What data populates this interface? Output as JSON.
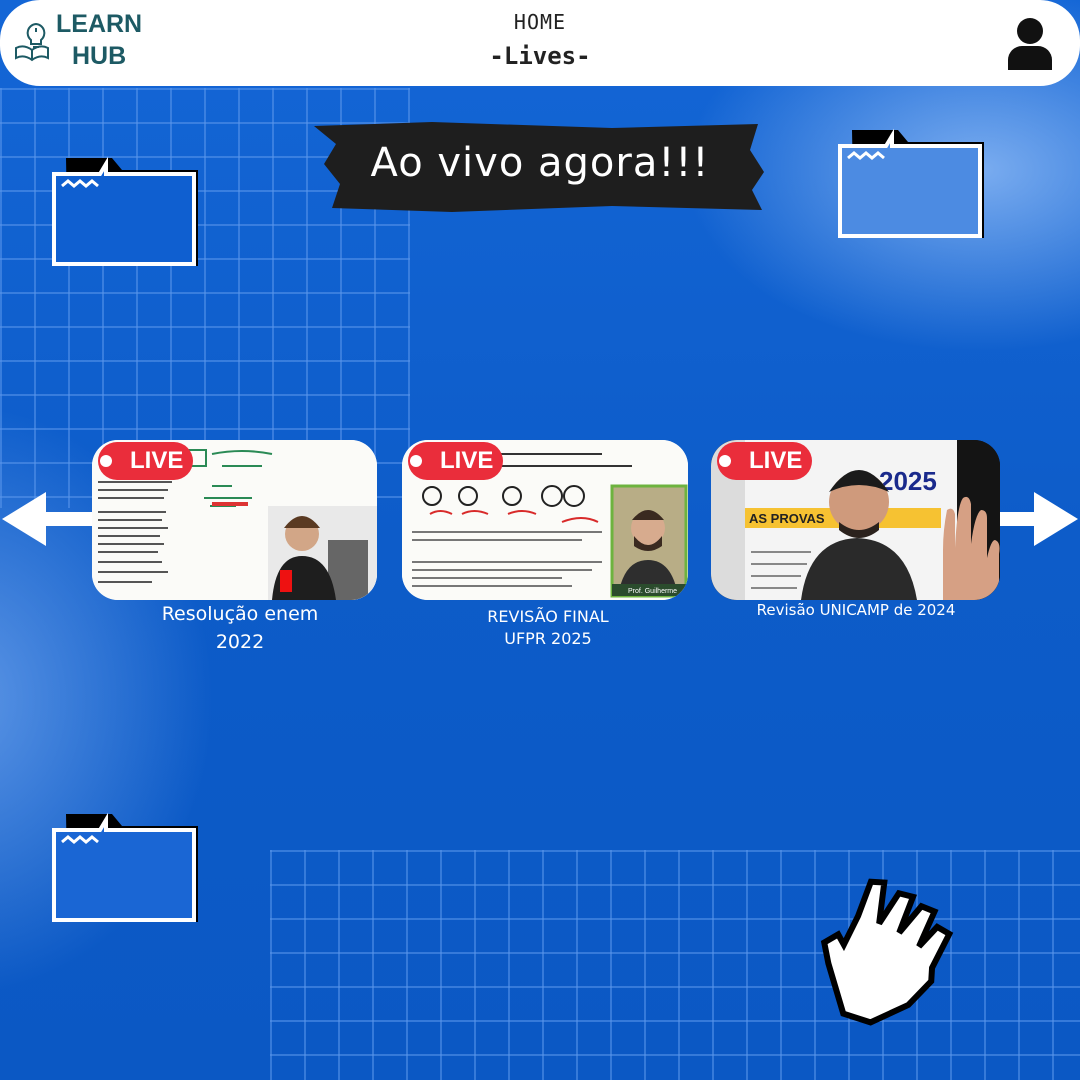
{
  "header": {
    "logo_line1": "LEARN",
    "logo_line2": "HUB",
    "nav_home": "HOME",
    "nav_current": "-Lives-"
  },
  "banner": {
    "text": "Ao vivo agora!!!"
  },
  "carousel": {
    "cards": [
      {
        "badge": "LIVE",
        "title_line1": "Resolução enem",
        "title_line2": "2022"
      },
      {
        "badge": "LIVE",
        "title_line1": "REVISÃO FINAL",
        "title_line2": "UFPR 2025",
        "thumb_name_tag": "Prof. Guilherme"
      },
      {
        "badge": "LIVE",
        "title_line1": "Revisão UNICAMP de 2024",
        "thumb_overlay_1": "AS PROVAS",
        "thumb_overlay_2": "2025"
      }
    ]
  },
  "colors": {
    "background": "#0f5fd0",
    "header_bg": "#ffffff",
    "logo_text": "#1d5a64",
    "live_badge": "#ea2d3b",
    "banner_bg": "#1e1e1e"
  },
  "icons": {
    "logo": "book-lightbulb-icon",
    "user": "user-icon",
    "folder": "folder-icon",
    "prev": "arrow-left-icon",
    "next": "arrow-right-icon",
    "pointer": "hand-pointer-icon"
  }
}
